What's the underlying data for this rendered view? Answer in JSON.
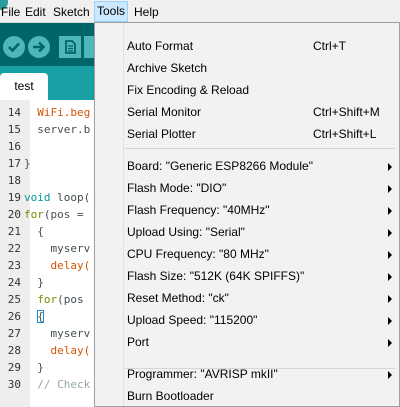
{
  "menubar": {
    "items": [
      "File",
      "Edit",
      "Sketch",
      "Tools",
      "Help"
    ],
    "active": "Tools"
  },
  "tab": {
    "label": "test"
  },
  "editor": {
    "line_numbers": [
      "14",
      "15",
      "16",
      "17",
      "18",
      "19",
      "20",
      "21",
      "22",
      "23",
      "24",
      "25",
      "26",
      "27",
      "28",
      "29",
      "30"
    ],
    "lines": [
      {
        "parts": [
          {
            "t": "  WiFi.beg",
            "c": "#d35400"
          }
        ]
      },
      {
        "parts": [
          {
            "t": "  server.b",
            "c": "#434f54"
          }
        ]
      },
      {
        "parts": [
          {
            "t": "",
            "c": "#434f54"
          }
        ]
      },
      {
        "parts": [
          {
            "t": "}",
            "c": "#434f54"
          }
        ]
      },
      {
        "parts": [
          {
            "t": "",
            "c": "#434f54"
          }
        ]
      },
      {
        "parts": [
          {
            "t": "void",
            "c": "#00979c"
          },
          {
            "t": " loop(",
            "c": "#434f54"
          }
        ]
      },
      {
        "parts": [
          {
            "t": "for",
            "c": "#728e00"
          },
          {
            "t": "(pos =",
            "c": "#434f54"
          }
        ]
      },
      {
        "parts": [
          {
            "t": "  {",
            "c": "#434f54"
          }
        ]
      },
      {
        "parts": [
          {
            "t": "    myserv",
            "c": "#434f54"
          }
        ]
      },
      {
        "parts": [
          {
            "t": "    delay(",
            "c": "#d35400"
          }
        ]
      },
      {
        "parts": [
          {
            "t": "  }",
            "c": "#434f54"
          }
        ]
      },
      {
        "parts": [
          {
            "t": "  ",
            "c": "#434f54"
          },
          {
            "t": "for",
            "c": "#728e00"
          },
          {
            "t": "(pos",
            "c": "#434f54"
          }
        ]
      },
      {
        "parts": [
          {
            "t": "  ",
            "c": "#434f54"
          },
          {
            "t": "{",
            "c": "#434f54",
            "box": true
          }
        ]
      },
      {
        "parts": [
          {
            "t": "    myserv",
            "c": "#434f54"
          }
        ]
      },
      {
        "parts": [
          {
            "t": "    delay(",
            "c": "#d35400"
          }
        ]
      },
      {
        "parts": [
          {
            "t": "  }",
            "c": "#434f54"
          }
        ]
      },
      {
        "parts": [
          {
            "t": "  // Check",
            "c": "#95a5a6"
          }
        ]
      }
    ]
  },
  "tools_menu": {
    "items": [
      {
        "label": "Auto Format",
        "shortcut": "Ctrl+T",
        "submenu": false
      },
      {
        "label": "Archive Sketch",
        "shortcut": "",
        "submenu": false
      },
      {
        "label": "Fix Encoding & Reload",
        "shortcut": "",
        "submenu": false
      },
      {
        "label": "Serial Monitor",
        "shortcut": "Ctrl+Shift+M",
        "submenu": false
      },
      {
        "label": "Serial Plotter",
        "shortcut": "Ctrl+Shift+L",
        "submenu": false
      },
      {
        "label": "Board: \"Generic ESP8266 Module\"",
        "shortcut": "",
        "submenu": true
      },
      {
        "label": "Flash Mode: \"DIO\"",
        "shortcut": "",
        "submenu": true
      },
      {
        "label": "Flash Frequency: \"40MHz\"",
        "shortcut": "",
        "submenu": true
      },
      {
        "label": "Upload Using: \"Serial\"",
        "shortcut": "",
        "submenu": true
      },
      {
        "label": "CPU Frequency: \"80 MHz\"",
        "shortcut": "",
        "submenu": true
      },
      {
        "label": "Flash Size: \"512K (64K SPIFFS)\"",
        "shortcut": "",
        "submenu": true
      },
      {
        "label": "Reset Method: \"ck\"",
        "shortcut": "",
        "submenu": true
      },
      {
        "label": "Upload Speed: \"115200\"",
        "shortcut": "",
        "submenu": true
      },
      {
        "label": "Port",
        "shortcut": "",
        "submenu": true
      },
      {
        "label": "Programmer: \"AVRISP mkII\"",
        "shortcut": "",
        "submenu": true
      },
      {
        "label": "Burn Bootloader",
        "shortcut": "",
        "submenu": false
      }
    ]
  },
  "colors": {
    "toolbar": "#006468",
    "tabstrip": "#17a1a5",
    "menu_highlight": "#cce8ff"
  },
  "icons": [
    "app-logo-icon",
    "verify-icon",
    "upload-icon",
    "new-sketch-icon",
    "submenu-arrow-icon"
  ]
}
